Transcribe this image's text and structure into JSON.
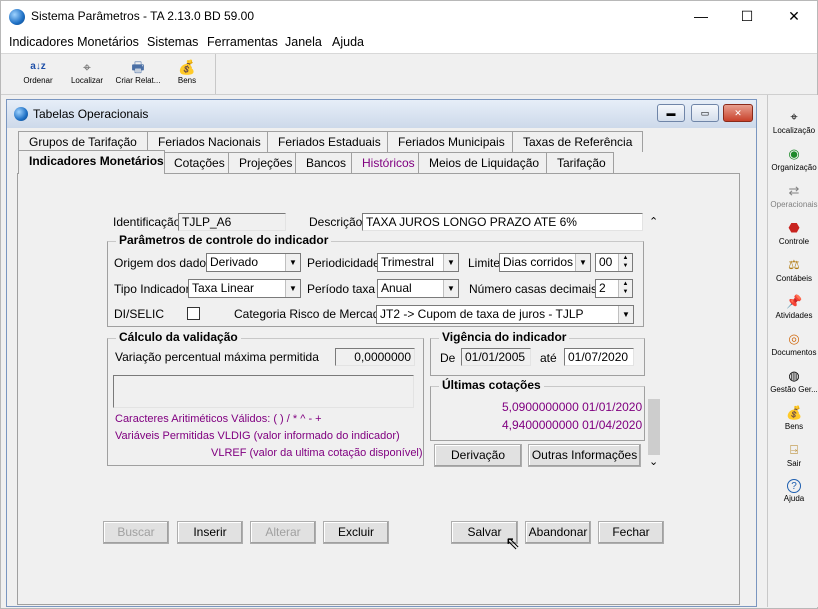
{
  "window": {
    "title": "Sistema Parâmetros -  TA 2.13.0 BD 59.00",
    "min": "—",
    "max": "☐",
    "close": "✕"
  },
  "menu": [
    "Indicadores Monetários",
    "Sistemas",
    "Ferramentas",
    "Janela",
    "Ajuda"
  ],
  "toolbar": [
    {
      "label": "Ordenar",
      "icon": "sort-az-icon"
    },
    {
      "label": "Localizar",
      "icon": "locate-icon"
    },
    {
      "label": "Criar Relat...",
      "icon": "printer-icon"
    },
    {
      "label": "Bens",
      "icon": "money-bag-icon"
    }
  ],
  "child": {
    "title": "Tabelas Operacionais"
  },
  "tabs_row1": [
    "Grupos de Tarifação",
    "Feriados Nacionais",
    "Feriados Estaduais",
    "Feriados Municipais",
    "Taxas de Referência"
  ],
  "tabs_row2": [
    "Indicadores Monetários",
    "Cotações",
    "Projeções",
    "Bancos",
    "Históricos",
    "Meios de Liquidação",
    "Tarifação"
  ],
  "form": {
    "identificacao_label": "Identificação",
    "identificacao_value": "TJLP_A6",
    "descricao_label": "Descrição",
    "descricao_value": "TAXA JUROS LONGO PRAZO ATE 6%",
    "params_title": "Parâmetros de controle do indicador",
    "origem_label": "Origem dos dados",
    "origem_value": "Derivado",
    "periodicidade_label": "Periodicidade",
    "periodicidade_value": "Trimestral",
    "limite_label": "Limite",
    "limite_value": "Dias corridos",
    "limite_num": "00",
    "tipo_label": "Tipo Indicador",
    "tipo_value": "Taxa Linear",
    "periodo_label": "Período taxa",
    "periodo_value": "Anual",
    "casas_label": "Número casas decimais",
    "casas_value": "2",
    "diselic_label": "DI/SELIC",
    "categoria_label": "Categoria Risco de Mercado",
    "categoria_value": "JT2 -> Cupom de taxa de juros - TJLP"
  },
  "validacao": {
    "title": "Cálculo da validação",
    "variacao_label": "Variação percentual máxima permitida",
    "variacao_value": "0,0000000",
    "caracteres": "Caracteres Aritiméticos Válidos:      ( ) / * ^ - +",
    "variaveis": "Variáveis Permitidas VLDIG  (valor informado do indicador)",
    "vlref": "VLREF (valor da ultima cotação disponível)"
  },
  "vigencia": {
    "title": "Vigência do indicador",
    "de_label": "De",
    "de_value": "01/01/2005",
    "ate_label": "até",
    "ate_value": "01/07/2020"
  },
  "cotacoes": {
    "title": "Últimas cotações",
    "rows": [
      "5,0900000000  01/01/2020",
      "4,9400000000  01/04/2020"
    ]
  },
  "buttons": {
    "derivacao": "Derivação",
    "outras": "Outras Informações",
    "buscar": "Buscar",
    "inserir": "Inserir",
    "alterar": "Alterar",
    "excluir": "Excluir",
    "salvar": "Salvar",
    "abandonar": "Abandonar",
    "fechar": "Fechar"
  },
  "sidebar": [
    {
      "label": "Localização",
      "icon": "locate-icon"
    },
    {
      "label": "Organização",
      "icon": "organization-icon"
    },
    {
      "label": "Operacionais",
      "icon": "operations-icon"
    },
    {
      "label": "Controle",
      "icon": "stop-icon"
    },
    {
      "label": "Contábeis",
      "icon": "scale-icon"
    },
    {
      "label": "Atividades",
      "icon": "pin-icon"
    },
    {
      "label": "Documentos",
      "icon": "documents-icon"
    },
    {
      "label": "Gestão Ger...",
      "icon": "eye-icon"
    },
    {
      "label": "Bens",
      "icon": "money-bag-icon"
    },
    {
      "label": "Sair",
      "icon": "exit-icon"
    },
    {
      "label": "Ajuda",
      "icon": "help-icon"
    }
  ]
}
